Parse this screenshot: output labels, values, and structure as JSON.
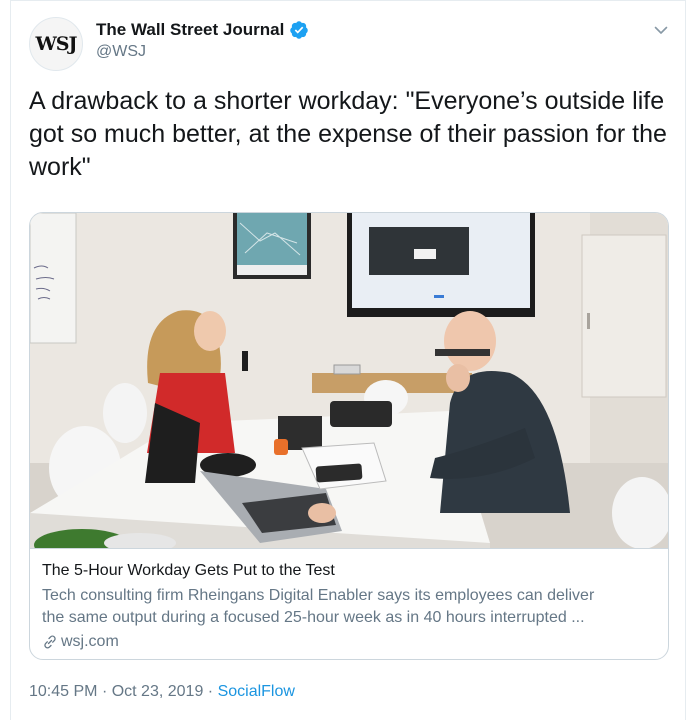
{
  "tweet": {
    "author_name": "The Wall Street Journal",
    "author_handle": "@WSJ",
    "avatar_text": "WSJ",
    "text": "A drawback to a shorter workday: \"Everyone’s outside life got so much better, at the expense of their passion for the work\"",
    "time": "10:45 PM",
    "date": "Oct 23, 2019",
    "source": "SocialFlow",
    "separator": "·"
  },
  "link_card": {
    "title": "The 5-Hour Workday Gets Put to the Test",
    "description_line1": "Tech consulting firm Rheingans Digital Enabler says its employees can deliver",
    "description_line2": "the same output during a focused 25-hour week as in 40 hours interrupted ...",
    "domain": "wsj.com"
  },
  "colors": {
    "verified": "#1da1f2",
    "link": "#1b95e0",
    "secondary_text": "#657786",
    "border": "#ccd6dd"
  },
  "icons": [
    "verified-badge-icon",
    "chevron-down-icon",
    "link-icon"
  ]
}
